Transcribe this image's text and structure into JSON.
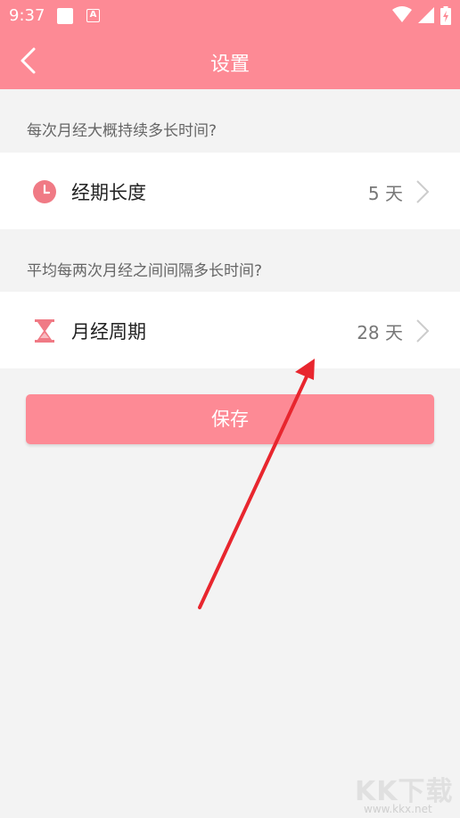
{
  "status_bar": {
    "time": "9:37",
    "notification_badge": "A",
    "icons": [
      "square-notification-icon",
      "a-badge-icon",
      "wifi-icon",
      "signal-icon",
      "battery-charging-icon"
    ]
  },
  "header": {
    "title": "设置",
    "back_icon": "chevron-left-icon",
    "background_color": "#fd8a95"
  },
  "sections": [
    {
      "question": "每次月经大概持续多长时间?",
      "row": {
        "icon": "clock-icon",
        "label": "经期长度",
        "value": "5 天"
      }
    },
    {
      "question": "平均每两次月经之间间隔多长时间?",
      "row": {
        "icon": "hourglass-icon",
        "label": "月经周期",
        "value": "28 天"
      }
    }
  ],
  "save_button": {
    "label": "保存",
    "color": "#fd8a95"
  },
  "annotation": {
    "arrow_color": "#e8262e"
  },
  "watermark": {
    "logo": "KK下载",
    "url": "www.kkx.net"
  }
}
